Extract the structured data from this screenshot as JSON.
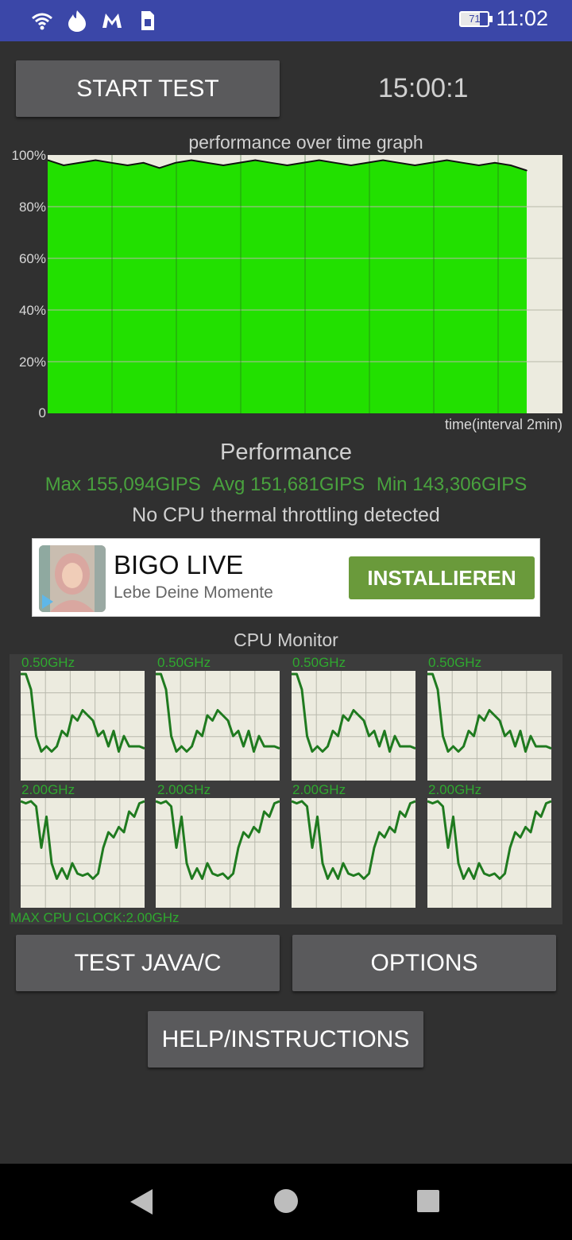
{
  "status_bar": {
    "icons": [
      "wifi-icon",
      "fire-icon",
      "app-m-icon",
      "sim-card-icon"
    ],
    "battery": "71",
    "time": "11:02"
  },
  "controls": {
    "start_label": "START TEST",
    "timer": "15:00:1",
    "test_java_label": "TEST JAVA/C",
    "options_label": "OPTIONS",
    "help_label": "HELP/INSTRUCTIONS"
  },
  "graph": {
    "title": "performance over time graph",
    "y_ticks": [
      "100%",
      "80%",
      "60%",
      "40%",
      "20%",
      "0"
    ],
    "time_label": "time(interval 2min)",
    "colors": {
      "fill": "#22e000",
      "background": "#ecebdf",
      "line": "#111111"
    }
  },
  "chart_data": {
    "type": "area",
    "title": "performance over time graph",
    "xlabel": "time(interval 2min)",
    "ylabel": "",
    "ylim": [
      0,
      100
    ],
    "x_unit": "minutes",
    "xlim": [
      0,
      16
    ],
    "grid": true,
    "series": [
      {
        "x": [
          0,
          0.5,
          1,
          1.5,
          2,
          2.5,
          3,
          3.5,
          4,
          4.5,
          5,
          5.5,
          6,
          6.5,
          7,
          7.5,
          8,
          8.5,
          9,
          9.5,
          10,
          10.5,
          11,
          11.5,
          12,
          12.5,
          13,
          13.5,
          14,
          14.5,
          15
        ],
        "values": [
          98,
          96,
          97,
          98,
          97,
          96,
          97,
          95,
          97,
          98,
          97,
          96,
          97,
          98,
          97,
          96,
          97,
          98,
          97,
          96,
          97,
          98,
          97,
          96,
          97,
          98,
          97,
          96,
          97,
          96,
          94
        ]
      }
    ]
  },
  "performance": {
    "title": "Performance",
    "max": "Max 155,094GIPS",
    "avg": "Avg 151,681GIPS",
    "min": "Min 143,306GIPS",
    "throttle": "No CPU thermal throttling detected"
  },
  "ad": {
    "name": "BIGO LIVE",
    "subtitle": "Lebe Deine Momente",
    "button": "INSTALLIEREN"
  },
  "cpu_monitor": {
    "title": "CPU Monitor",
    "max_clock": "MAX CPU CLOCK:2.00GHz",
    "cores": [
      {
        "freq": "0.50GHz"
      },
      {
        "freq": "0.50GHz"
      },
      {
        "freq": "0.50GHz"
      },
      {
        "freq": "0.50GHz"
      },
      {
        "freq": "2.00GHz"
      },
      {
        "freq": "2.00GHz"
      },
      {
        "freq": "2.00GHz"
      },
      {
        "freq": "2.00GHz"
      }
    ],
    "traces": {
      "little": [
        100,
        100,
        85,
        40,
        25,
        30,
        25,
        30,
        45,
        40,
        60,
        55,
        65,
        60,
        55,
        40,
        45,
        30,
        45,
        25,
        40,
        30,
        30,
        30,
        28
      ],
      "big": [
        100,
        98,
        100,
        95,
        55,
        85,
        40,
        25,
        35,
        25,
        40,
        30,
        28,
        30,
        25,
        30,
        55,
        70,
        65,
        75,
        70,
        90,
        85,
        98,
        100
      ]
    }
  },
  "nav": {
    "icons": [
      "back-icon",
      "home-icon",
      "recents-icon"
    ]
  }
}
